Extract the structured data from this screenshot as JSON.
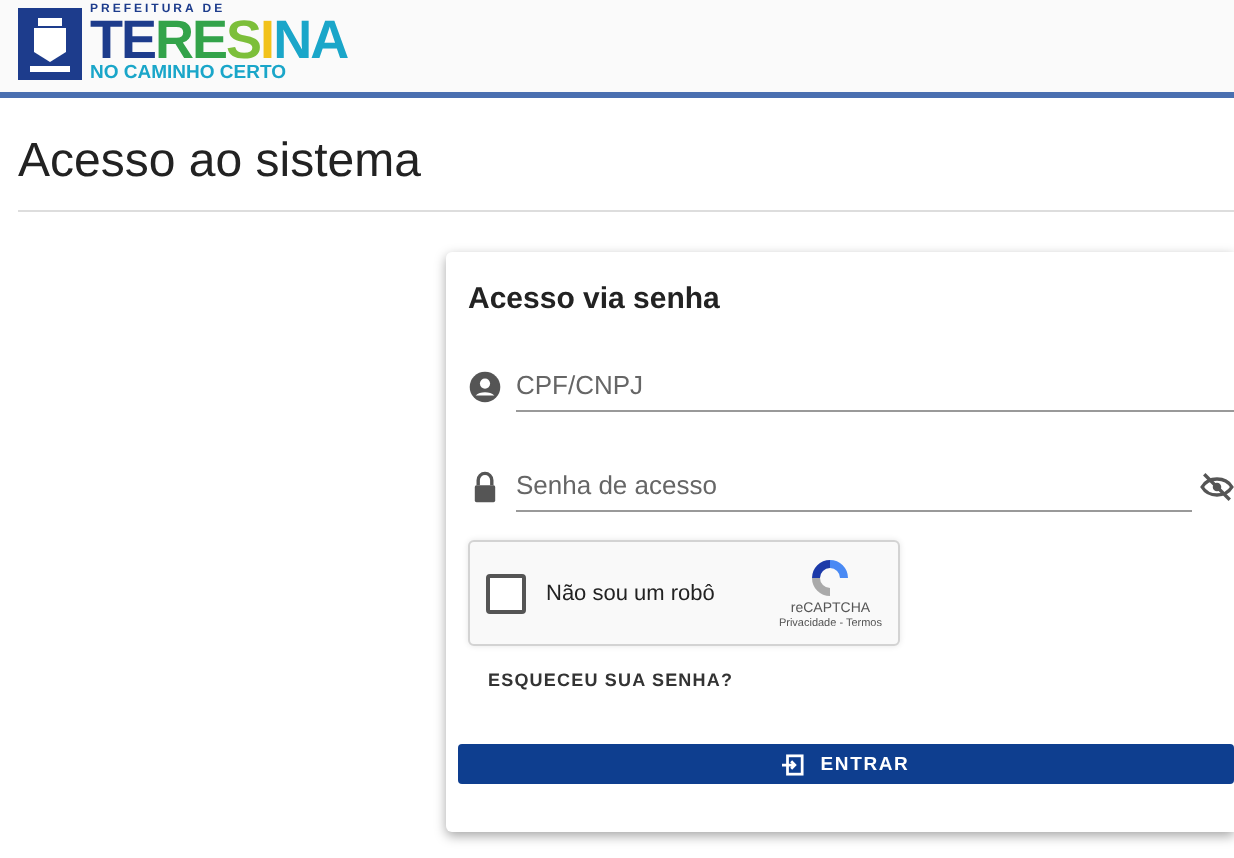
{
  "header": {
    "logo": {
      "top_line": "PREFEITURA DE",
      "name": "TERESINA",
      "tagline": "NO CAMINHO CERTO"
    }
  },
  "page_title": "Acesso ao sistema",
  "login_card": {
    "title": "Acesso via senha",
    "fields": [
      {
        "kind": "user",
        "placeholder": "CPF/CNPJ"
      },
      {
        "kind": "password",
        "placeholder": "Senha de acesso"
      }
    ],
    "captcha": {
      "label": "Não sou um robô",
      "checked": false,
      "brand": "reCAPTCHA",
      "links": "Privacidade - Termos"
    },
    "forgot_link": "ESQUECEU SUA SENHA?",
    "submit_button": "ENTRAR"
  }
}
